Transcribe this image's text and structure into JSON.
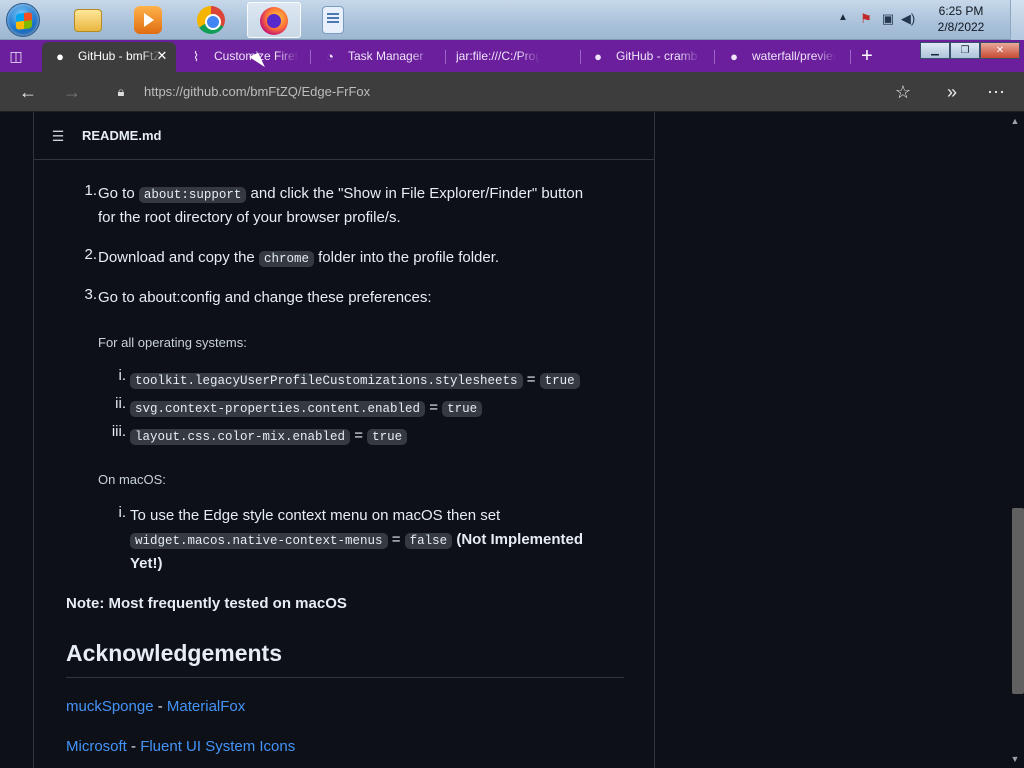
{
  "taskbar": {
    "apps": [
      {
        "name": "Windows Explorer"
      },
      {
        "name": "Windows Media Player"
      },
      {
        "name": "Google Chrome"
      },
      {
        "name": "Firefox"
      },
      {
        "name": "Document"
      }
    ],
    "clock": {
      "time": "6:25 PM",
      "date": "2/8/2022"
    }
  },
  "browser": {
    "tabs": [
      {
        "label": "GitHub - bmFtZQ/Edge-FrFox",
        "icon": "github-icon",
        "active": true
      },
      {
        "label": "Customize Firefox",
        "icon": "paintbrush-icon"
      },
      {
        "label": "Task Manager",
        "icon": "gauge-icon"
      },
      {
        "label": "jar:file:///C:/Program Files",
        "icon": ""
      },
      {
        "label": "GitHub - cramb",
        "icon": "github-icon"
      },
      {
        "label": "waterfall/preview",
        "icon": "github-icon"
      }
    ],
    "url": "https://github.com/bmFtZQ/Edge-FrFox"
  },
  "readme": {
    "title": "README.md",
    "steps": [
      {
        "n": "1.",
        "pre": "Go to ",
        "code": "about:support",
        "post": " and click the \"Show in File Explorer/Finder\" button",
        "line2": "for the root directory of your browser profile/s."
      },
      {
        "n": "2.",
        "pre": "Download and copy the ",
        "code": "chrome",
        "post": " folder into the profile folder."
      },
      {
        "n": "3.",
        "text": "Go to about:config and change these preferences:"
      }
    ],
    "all_os_label": "For all operating systems:",
    "prefs": [
      {
        "n": "i.",
        "key": "toolkit.legacyUserProfileCustomizations.stylesheets",
        "eq": "=",
        "val": "true"
      },
      {
        "n": "ii.",
        "key": "svg.context-properties.content.enabled",
        "eq": "=",
        "val": "true"
      },
      {
        "n": "iii.",
        "key": "layout.css.color-mix.enabled",
        "eq": "=",
        "val": "true"
      }
    ],
    "macos_label": "On macOS:",
    "macos_item": {
      "n": "i.",
      "text": "To use the Edge style context menu on macOS then set",
      "key": "widget.macos.native-context-menus",
      "eq": "=",
      "val": "false",
      "note1": "(Not Implemented",
      "note2": "Yet!)"
    },
    "note": "Note: Most frequently tested on macOS",
    "ack_heading": "Acknowledgements",
    "acks": [
      {
        "author": "muckSponge",
        "sep": " - ",
        "project": "MaterialFox"
      },
      {
        "author": "Microsoft",
        "sep": " - ",
        "project": "Fluent UI System Icons"
      }
    ]
  },
  "colors": {
    "tabstrip": "#6b1f9c",
    "page_bg": "#0d1117",
    "link": "#4493f8",
    "code_bg": "#343942"
  }
}
